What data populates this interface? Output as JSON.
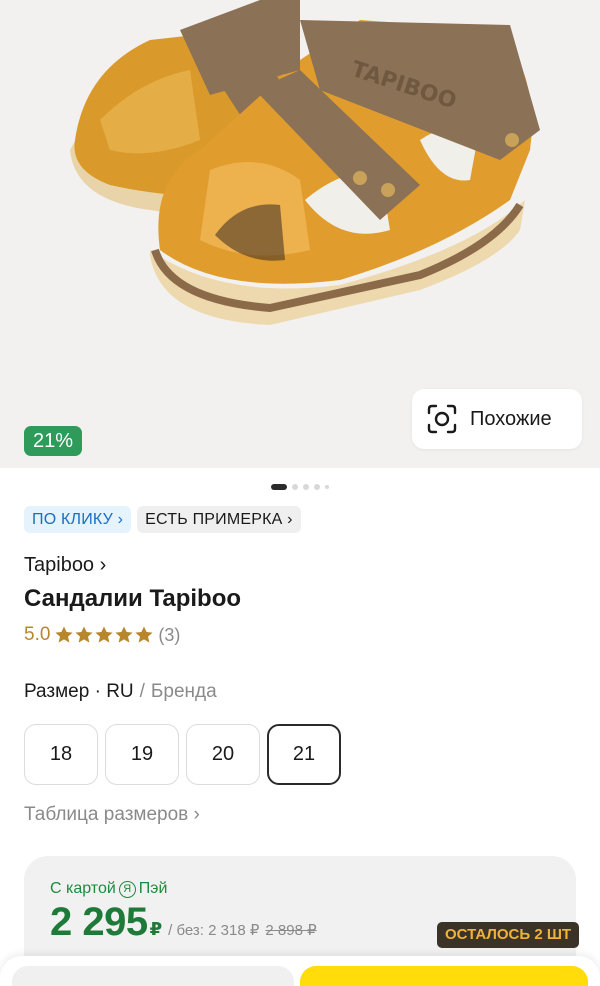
{
  "product_image": {
    "discount_label": "21%",
    "similar_button_label": "Похожие",
    "similar_icon": "visual-search-icon"
  },
  "pager": {
    "count": 5,
    "active_index": 0
  },
  "chips": [
    {
      "label": "ПО КЛИКУ ›",
      "style": "blue"
    },
    {
      "label": "ЕСТЬ ПРИМЕРКА ›",
      "style": "gray"
    }
  ],
  "brand_link": "Tapiboo ›",
  "product_title": "Сандалии Tapiboo",
  "rating": {
    "value": "5.0",
    "stars": 5,
    "count": "(3)",
    "star_color": "#b8862b"
  },
  "size_selector": {
    "label": "Размер · RU",
    "separator": "/",
    "alt_label": "Бренда"
  },
  "sizes": [
    {
      "value": "18",
      "selected": false
    },
    {
      "value": "19",
      "selected": false
    },
    {
      "value": "20",
      "selected": false
    },
    {
      "value": "21",
      "selected": true
    }
  ],
  "size_table_link": "Таблица размеров ›",
  "price_card": {
    "pay_prefix": "С картой",
    "pay_badge": "Я",
    "pay_suffix": "Пэй",
    "price": "2 295",
    "currency": "₽",
    "without_label": "/ без: 2 318 ₽",
    "old_price": "2 898 ₽",
    "price_color": "#1f7a3a"
  },
  "stock_badge": "ОСТАЛОСЬ 2 ШТ",
  "colors": {
    "accent_yellow": "#ffdc0a",
    "discount_green": "#2e9b5b",
    "chip_blue": "#1c6dc3"
  }
}
